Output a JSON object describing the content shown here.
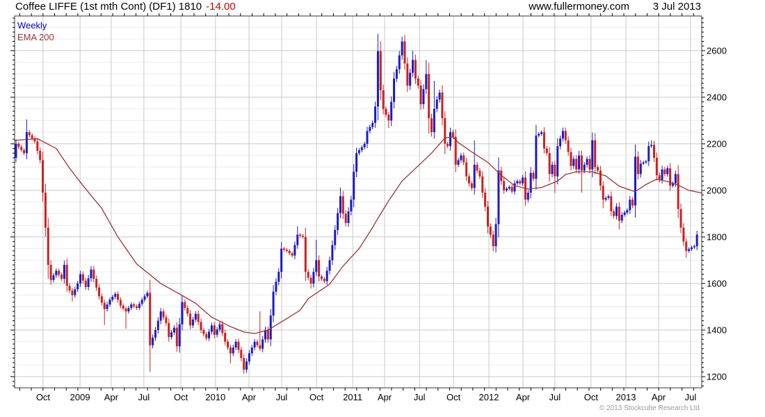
{
  "header": {
    "title": "Coffee LIFFE (1st mth Cont) (DF1) 1810",
    "change": "-14.00",
    "website": "www.fullermoney.com",
    "date": "3 Jul 2013"
  },
  "legend": {
    "timeframe": "Weekly",
    "overlay": "EMA 200"
  },
  "footer": {
    "copyright": "© 2013 Stockcube Research Ltd"
  },
  "colors": {
    "up": "#1a1acc",
    "down": "#cc2020",
    "ema": "#993333",
    "grid_major": "#c8c8c8",
    "grid_minor": "#ececec",
    "axis": "#333333",
    "tick": "#000000",
    "label": "#000000",
    "title": "#000000",
    "change": "#cc0000",
    "copyright": "#9a9a9a",
    "legend_weekly": "#0000cc",
    "legend_ema": "#993333"
  },
  "chart_data": {
    "type": "candlestick",
    "title": "Coffee LIFFE (1st mth Cont) (DF1)",
    "subtitle": "Weekly with EMA 200",
    "last_price": 1810,
    "change_value": -14.0,
    "grid": true,
    "legend_position": "top-left",
    "ylabel": "",
    "xlabel": "",
    "y_range": [
      1152,
      2749
    ],
    "y_ticks": [
      1200,
      1400,
      1600,
      1800,
      2000,
      2200,
      2400,
      2600
    ],
    "y_minor_step": 50,
    "y_tick_step": 20,
    "weeks_total": 255,
    "open_first": 2140,
    "x_ticks": [
      {
        "label": "Oct",
        "week": 10.1
      },
      {
        "label": "2009",
        "week": 23.9
      },
      {
        "label": "Apr",
        "week": 35.5
      },
      {
        "label": "Jul",
        "week": 47.7
      },
      {
        "label": "Oct",
        "week": 61.5
      },
      {
        "label": "2010",
        "week": 74.4
      },
      {
        "label": "Apr",
        "week": 86.9
      },
      {
        "label": "Jul",
        "week": 99.1
      },
      {
        "label": "Oct",
        "week": 112.1
      },
      {
        "label": "2011",
        "week": 125.6
      },
      {
        "label": "Apr",
        "week": 137.5
      },
      {
        "label": "Jul",
        "week": 150.5
      },
      {
        "label": "Oct",
        "week": 163.2
      },
      {
        "label": "2012",
        "week": 176.4
      },
      {
        "label": "Apr",
        "week": 189.1
      },
      {
        "label": "Jul",
        "week": 201.0
      },
      {
        "label": "Oct",
        "week": 214.5
      },
      {
        "label": "2013",
        "week": 227.5
      },
      {
        "label": "Apr",
        "week": 239.7
      },
      {
        "label": "Jul",
        "week": 251.6
      }
    ],
    "close_keyframes": [
      [
        0,
        2200
      ],
      [
        3,
        2160
      ],
      [
        4,
        2250
      ],
      [
        7,
        2210
      ],
      [
        9,
        2130
      ],
      [
        10,
        1990
      ],
      [
        11,
        1840
      ],
      [
        12,
        1680
      ],
      [
        13,
        1615
      ],
      [
        15,
        1655
      ],
      [
        17,
        1620
      ],
      [
        18,
        1680
      ],
      [
        19,
        1590
      ],
      [
        21,
        1550
      ],
      [
        23,
        1600
      ],
      [
        24,
        1640
      ],
      [
        26,
        1585
      ],
      [
        28,
        1660
      ],
      [
        29,
        1620
      ],
      [
        31,
        1545
      ],
      [
        33,
        1490
      ],
      [
        35,
        1530
      ],
      [
        37,
        1555
      ],
      [
        39,
        1505
      ],
      [
        41,
        1480
      ],
      [
        43,
        1510
      ],
      [
        45,
        1495
      ],
      [
        47,
        1530
      ],
      [
        49,
        1560
      ],
      [
        50,
        1335
      ],
      [
        52,
        1400
      ],
      [
        54,
        1480
      ],
      [
        56,
        1430
      ],
      [
        57,
        1370
      ],
      [
        59,
        1410
      ],
      [
        60,
        1330
      ],
      [
        62,
        1520
      ],
      [
        64,
        1470
      ],
      [
        65,
        1420
      ],
      [
        67,
        1470
      ],
      [
        69,
        1400
      ],
      [
        71,
        1365
      ],
      [
        73,
        1420
      ],
      [
        74,
        1380
      ],
      [
        76,
        1425
      ],
      [
        78,
        1350
      ],
      [
        80,
        1300
      ],
      [
        82,
        1350
      ],
      [
        84,
        1280
      ],
      [
        85,
        1230
      ],
      [
        87,
        1300
      ],
      [
        89,
        1350
      ],
      [
        91,
        1320
      ],
      [
        93,
        1400
      ],
      [
        94,
        1360
      ],
      [
        96,
        1565
      ],
      [
        98,
        1650
      ],
      [
        99,
        1750
      ],
      [
        101,
        1740
      ],
      [
        103,
        1720
      ],
      [
        105,
        1810
      ],
      [
        107,
        1800
      ],
      [
        108,
        1650
      ],
      [
        110,
        1600
      ],
      [
        112,
        1700
      ],
      [
        113,
        1630
      ],
      [
        115,
        1610
      ],
      [
        117,
        1700
      ],
      [
        119,
        1830
      ],
      [
        121,
        1975
      ],
      [
        122,
        1900
      ],
      [
        123,
        1860
      ],
      [
        125,
        1960
      ],
      [
        126,
        2080
      ],
      [
        127,
        2160
      ],
      [
        129,
        2185
      ],
      [
        130,
        2200
      ],
      [
        131,
        2255
      ],
      [
        133,
        2290
      ],
      [
        134,
        2360
      ],
      [
        135,
        2598
      ],
      [
        136,
        2430
      ],
      [
        137,
        2350
      ],
      [
        139,
        2300
      ],
      [
        140,
        2380
      ],
      [
        141,
        2480
      ],
      [
        142,
        2520
      ],
      [
        144,
        2640
      ],
      [
        145,
        2545
      ],
      [
        146,
        2450
      ],
      [
        148,
        2560
      ],
      [
        149,
        2480
      ],
      [
        150,
        2450
      ],
      [
        151,
        2370
      ],
      [
        153,
        2500
      ],
      [
        154,
        2310
      ],
      [
        155,
        2250
      ],
      [
        156,
        2350
      ],
      [
        157,
        2390
      ],
      [
        158,
        2420
      ],
      [
        159,
        2310
      ],
      [
        160,
        2200
      ],
      [
        161,
        2190
      ],
      [
        162,
        2250
      ],
      [
        163,
        2230
      ],
      [
        164,
        2110
      ],
      [
        166,
        2150
      ],
      [
        167,
        2120
      ],
      [
        168,
        2060
      ],
      [
        169,
        2030
      ],
      [
        170,
        2010
      ],
      [
        171,
        2110
      ],
      [
        173,
        2060
      ],
      [
        174,
        1990
      ],
      [
        175,
        1930
      ],
      [
        176,
        1845
      ],
      [
        177,
        1810
      ],
      [
        178,
        1760
      ],
      [
        179,
        1855
      ],
      [
        180,
        2085
      ],
      [
        181,
        2040
      ],
      [
        182,
        2000
      ],
      [
        184,
        2015
      ],
      [
        185,
        1995
      ],
      [
        186,
        2030
      ],
      [
        187,
        2040
      ],
      [
        188,
        2030
      ],
      [
        189,
        2055
      ],
      [
        190,
        1960
      ],
      [
        191,
        1990
      ],
      [
        192,
        2075
      ],
      [
        193,
        2050
      ],
      [
        194,
        2235
      ],
      [
        196,
        2250
      ],
      [
        197,
        2180
      ],
      [
        198,
        2160
      ],
      [
        199,
        2070
      ],
      [
        200,
        2110
      ],
      [
        201,
        2060
      ],
      [
        202,
        2190
      ],
      [
        204,
        2255
      ],
      [
        205,
        2215
      ],
      [
        206,
        2165
      ],
      [
        207,
        2105
      ],
      [
        208,
        2135
      ],
      [
        209,
        2090
      ],
      [
        210,
        2150
      ],
      [
        211,
        2085
      ],
      [
        213,
        2135
      ],
      [
        214,
        2090
      ],
      [
        215,
        2215
      ],
      [
        216,
        2100
      ],
      [
        217,
        2085
      ],
      [
        218,
        2020
      ],
      [
        219,
        1960
      ],
      [
        221,
        1975
      ],
      [
        222,
        1910
      ],
      [
        223,
        1890
      ],
      [
        224,
        1930
      ],
      [
        225,
        1870
      ],
      [
        226,
        1895
      ],
      [
        228,
        1915
      ],
      [
        229,
        1960
      ],
      [
        230,
        1935
      ],
      [
        231,
        2145
      ],
      [
        232,
        2070
      ],
      [
        233,
        2115
      ],
      [
        235,
        2125
      ],
      [
        236,
        2190
      ],
      [
        237,
        2195
      ],
      [
        238,
        2140
      ],
      [
        239,
        2065
      ],
      [
        240,
        2045
      ],
      [
        241,
        2090
      ],
      [
        242,
        2070
      ],
      [
        243,
        2095
      ],
      [
        244,
        2020
      ],
      [
        245,
        2030
      ],
      [
        246,
        2070
      ],
      [
        247,
        1920
      ],
      [
        248,
        1840
      ],
      [
        249,
        1780
      ],
      [
        250,
        1740
      ],
      [
        252,
        1755
      ],
      [
        253,
        1760
      ],
      [
        254,
        1810
      ]
    ],
    "spikes": {
      "highs": [
        [
          4,
          2305
        ],
        [
          62,
          1540
        ],
        [
          91,
          1481
        ],
        [
          105,
          1846
        ],
        [
          112,
          1788
        ],
        [
          121,
          2012
        ],
        [
          135,
          2672
        ],
        [
          144,
          2660
        ],
        [
          148,
          2600
        ],
        [
          153,
          2560
        ],
        [
          156,
          2470
        ],
        [
          171,
          2215
        ],
        [
          180,
          2092
        ],
        [
          194,
          2245
        ],
        [
          204,
          2270
        ],
        [
          215,
          2225
        ],
        [
          231,
          2160
        ],
        [
          237,
          2215
        ],
        [
          254,
          1822
        ]
      ],
      "lows": [
        [
          12,
          1620
        ],
        [
          21,
          1523
        ],
        [
          33,
          1421
        ],
        [
          41,
          1406
        ],
        [
          50,
          1221
        ],
        [
          80,
          1257
        ],
        [
          85,
          1212
        ],
        [
          110,
          1578
        ],
        [
          139,
          2268
        ],
        [
          154,
          2244
        ],
        [
          160,
          2155
        ],
        [
          170,
          2004
        ],
        [
          176,
          1815
        ],
        [
          178,
          1738
        ],
        [
          190,
          1936
        ],
        [
          199,
          2038
        ],
        [
          201,
          1988
        ],
        [
          211,
          1990
        ],
        [
          219,
          1923
        ],
        [
          225,
          1833
        ],
        [
          247,
          1903
        ],
        [
          250,
          1711
        ]
      ]
    },
    "ema_keyframes": [
      [
        -0.5,
        2213
      ],
      [
        0,
        2215
      ],
      [
        8,
        2222
      ],
      [
        15,
        2180
      ],
      [
        20,
        2095
      ],
      [
        25,
        2020
      ],
      [
        32,
        1922
      ],
      [
        38,
        1800
      ],
      [
        45,
        1684
      ],
      [
        54,
        1600
      ],
      [
        61,
        1555
      ],
      [
        67,
        1515
      ],
      [
        73,
        1455
      ],
      [
        80,
        1415
      ],
      [
        85,
        1392
      ],
      [
        89,
        1385
      ],
      [
        94,
        1400
      ],
      [
        99,
        1435
      ],
      [
        106,
        1485
      ],
      [
        109,
        1535
      ],
      [
        117,
        1597
      ],
      [
        122,
        1675
      ],
      [
        128,
        1750
      ],
      [
        133,
        1840
      ],
      [
        135,
        1880
      ],
      [
        139,
        1955
      ],
      [
        144,
        2040
      ],
      [
        150,
        2105
      ],
      [
        155,
        2160
      ],
      [
        160,
        2225
      ],
      [
        163,
        2230
      ],
      [
        165,
        2205
      ],
      [
        170,
        2165
      ],
      [
        176,
        2120
      ],
      [
        181,
        2065
      ],
      [
        186,
        2020
      ],
      [
        191,
        2006
      ],
      [
        196,
        2012
      ],
      [
        202,
        2040
      ],
      [
        205,
        2068
      ],
      [
        209,
        2080
      ],
      [
        215,
        2080
      ],
      [
        220,
        2062
      ],
      [
        225,
        2018
      ],
      [
        230,
        1998
      ],
      [
        231,
        1995
      ],
      [
        235,
        2025
      ],
      [
        239,
        2048
      ],
      [
        243,
        2038
      ],
      [
        247,
        2022
      ],
      [
        251,
        2000
      ],
      [
        256,
        1988
      ]
    ]
  }
}
